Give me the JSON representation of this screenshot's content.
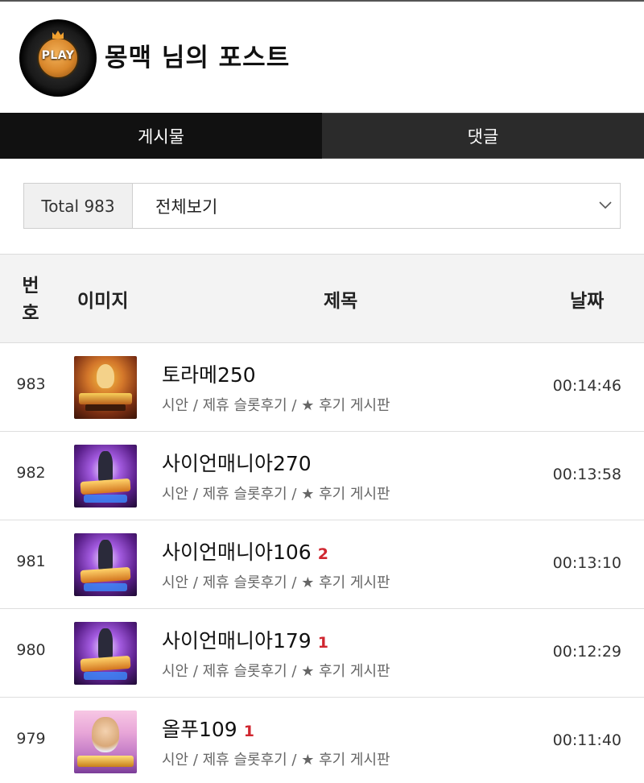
{
  "header": {
    "avatar_text": "PLAY",
    "title": "몽맥 님의 포스트"
  },
  "tabs": [
    {
      "label": "게시물",
      "active": true
    },
    {
      "label": "댓글",
      "active": false
    }
  ],
  "filter": {
    "total_label": "Total 983",
    "select_value": "전체보기"
  },
  "table": {
    "headers": {
      "number": "번호",
      "image": "이미지",
      "title": "제목",
      "date": "날짜"
    },
    "rows": [
      {
        "number": "983",
        "title": "토라메250",
        "comments": "",
        "meta": "시안 / 제휴 슬롯후기 / ★ 후기 게시판",
        "date": "00:14:46",
        "thumb": "5-rabbits-megaways-thumbnail"
      },
      {
        "number": "982",
        "title": "사이언매니아270",
        "comments": "",
        "meta": "시안 / 제휴 슬롯후기 / ★ 후기 게시판",
        "date": "00:13:58",
        "thumb": "zeus-mania-thumbnail"
      },
      {
        "number": "981",
        "title": "사이언매니아106",
        "comments": "2",
        "meta": "시안 / 제휴 슬롯후기 / ★ 후기 게시판",
        "date": "00:13:10",
        "thumb": "zeus-mania-thumbnail"
      },
      {
        "number": "980",
        "title": "사이언매니아179",
        "comments": "1",
        "meta": "시안 / 제휴 슬롯후기 / ★ 후기 게시판",
        "date": "00:12:29",
        "thumb": "zeus-mania-thumbnail"
      },
      {
        "number": "979",
        "title": "올푸109",
        "comments": "1",
        "meta": "시안 / 제휴 슬롯후기 / ★ 후기 게시판",
        "date": "00:11:40",
        "thumb": "gates-of-olympus-thumbnail"
      }
    ]
  },
  "colors": {
    "tab_active_bg": "#111111",
    "tab_inactive_bg": "#2b2b2b",
    "comment_count": "#d0262f"
  }
}
